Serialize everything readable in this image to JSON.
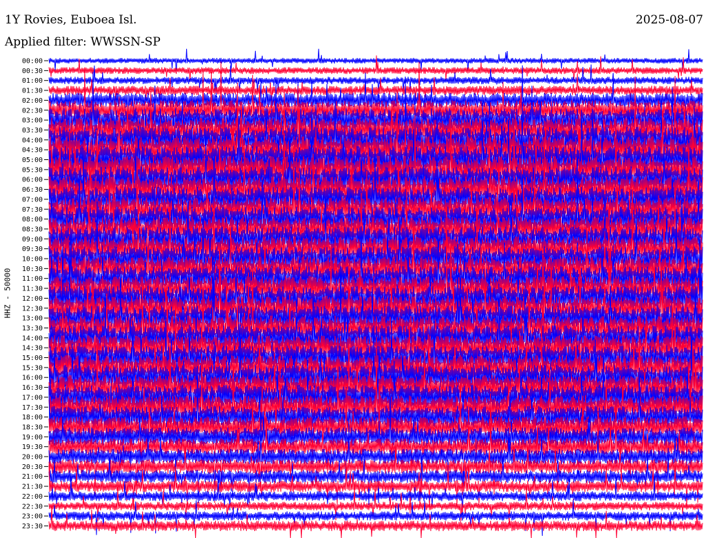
{
  "header": {
    "station": "1Y Rovies, Euboea Isl.",
    "date": "2025-08-07",
    "filter": "Applied filter: WWSSN-SP"
  },
  "chart_data": {
    "type": "helicorder",
    "title": "1Y Rovies, Euboea Isl.",
    "date": "2025-08-07",
    "filter": "WWSSN-SP",
    "ylabel": "HHZ - 50000",
    "xlabel": "",
    "row_interval_minutes": 30,
    "trace_colors": [
      "#0000ff",
      "#ff0033"
    ],
    "y_tick_labels": [
      "00:00",
      "00:30",
      "01:00",
      "01:30",
      "02:00",
      "02:30",
      "03:00",
      "03:30",
      "04:00",
      "04:30",
      "05:00",
      "05:30",
      "06:00",
      "06:30",
      "07:00",
      "07:30",
      "08:00",
      "08:30",
      "09:00",
      "09:30",
      "10:00",
      "10:30",
      "11:00",
      "11:30",
      "12:00",
      "12:30",
      "13:00",
      "13:30",
      "14:00",
      "14:30",
      "15:00",
      "15:30",
      "16:00",
      "16:30",
      "17:00",
      "17:30",
      "18:00",
      "18:30",
      "19:00",
      "19:30",
      "20:00",
      "20:30",
      "21:00",
      "21:30",
      "22:00",
      "22:30",
      "23:00",
      "23:30"
    ],
    "relative_amplitude_per_row": [
      0.45,
      0.55,
      0.6,
      0.75,
      1.2,
      1.6,
      1.9,
      2.0,
      2.1,
      2.2,
      2.2,
      2.2,
      2.1,
      2.1,
      2.0,
      2.0,
      2.0,
      2.0,
      2.0,
      2.0,
      2.0,
      2.0,
      2.0,
      2.0,
      2.0,
      2.0,
      2.0,
      2.0,
      2.0,
      2.0,
      2.0,
      2.0,
      2.0,
      2.0,
      2.0,
      1.9,
      1.8,
      1.7,
      1.5,
      1.35,
      1.25,
      1.15,
      1.05,
      0.95,
      0.8,
      0.7,
      0.75,
      0.85
    ]
  }
}
